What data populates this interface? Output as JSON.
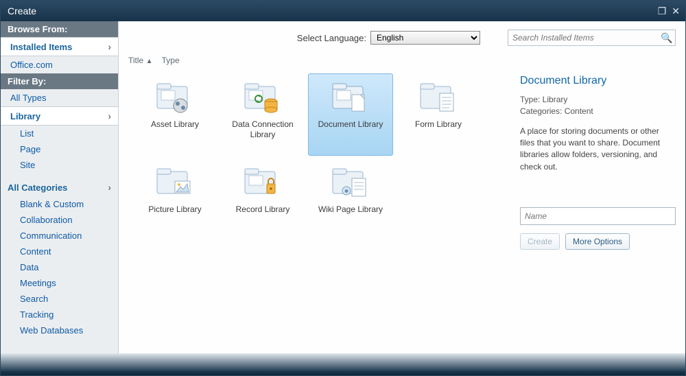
{
  "window": {
    "title": "Create"
  },
  "sidebar": {
    "browse_header": "Browse From:",
    "installed_label": "Installed Items",
    "office_label": "Office.com",
    "filter_header": "Filter By:",
    "alltypes_label": "All Types",
    "library_label": "Library",
    "subtypes": {
      "list": "List",
      "page": "Page",
      "site": "Site"
    },
    "allcats_label": "All Categories",
    "categories": [
      "Blank & Custom",
      "Collaboration",
      "Communication",
      "Content",
      "Data",
      "Meetings",
      "Search",
      "Tracking",
      "Web Databases"
    ]
  },
  "topband": {
    "lang_label": "Select Language:",
    "lang_value": "English",
    "search_placeholder": "Search Installed Items"
  },
  "sort": {
    "title_label": "Title",
    "type_label": "Type"
  },
  "tiles": {
    "asset": "Asset Library",
    "dataconn": "Data Connection Library",
    "document": "Document Library",
    "form": "Form Library",
    "picture": "Picture Library",
    "record": "Record Library",
    "wiki": "Wiki Page Library"
  },
  "details": {
    "title": "Document Library",
    "type_line": "Type: Library",
    "cat_line": "Categories: Content",
    "description": "A place for storing documents or other files that you want to share. Document libraries allow folders, versioning, and check out.",
    "name_placeholder": "Name",
    "create_btn": "Create",
    "more_btn": "More Options"
  }
}
